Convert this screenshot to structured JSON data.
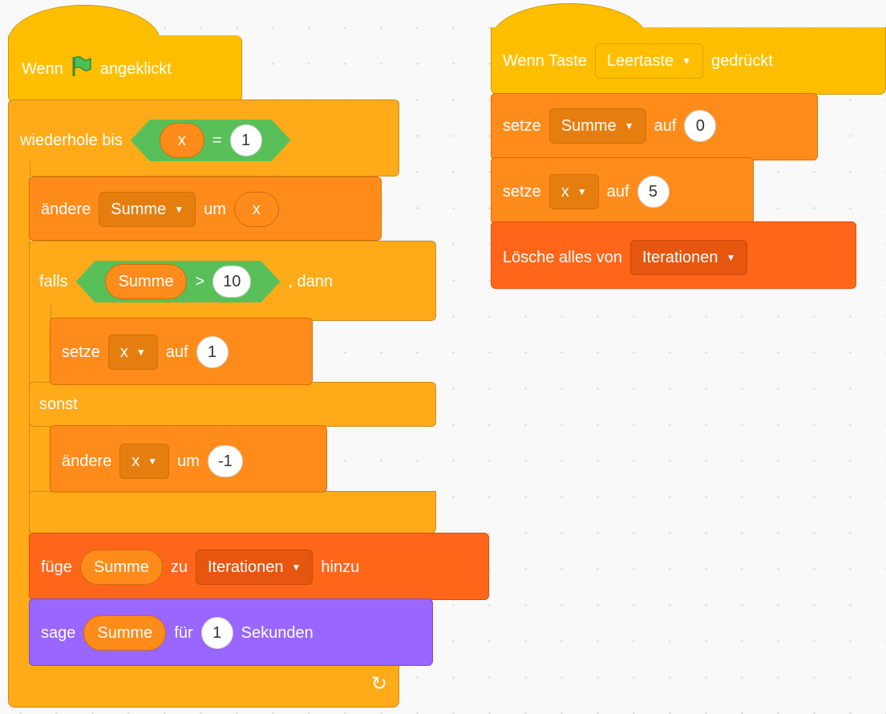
{
  "script1": {
    "hat": {
      "wenn": "Wenn",
      "flag": "green-flag-icon",
      "angeklickt": "angeklickt"
    },
    "repeat": {
      "label": "wiederhole bis",
      "var": "x",
      "op": "=",
      "value": "1"
    },
    "change1": {
      "label": "ändere",
      "var": "Summe",
      "um": "um",
      "rep": "x"
    },
    "if": {
      "falls": "falls",
      "var": "Summe",
      "op": ">",
      "value": "10",
      "dann": ", dann",
      "sonst": "sonst"
    },
    "set_x": {
      "label": "setze",
      "var": "x",
      "auf": "auf",
      "value": "1"
    },
    "change_x": {
      "label": "ändere",
      "var": "x",
      "um": "um",
      "value": "-1"
    },
    "add": {
      "label": "füge",
      "rep": "Summe",
      "zu": "zu",
      "list": "Iterationen",
      "hinzu": "hinzu"
    },
    "say": {
      "label": "sage",
      "rep": "Summe",
      "fuer": "für",
      "value": "1",
      "sek": "Sekunden"
    },
    "loop_icon": "↻"
  },
  "script2": {
    "hat": {
      "wenn": "Wenn Taste",
      "key": "Leertaste",
      "gedrueckt": "gedrückt"
    },
    "set_sum": {
      "label": "setze",
      "var": "Summe",
      "auf": "auf",
      "value": "0"
    },
    "set_x": {
      "label": "setze",
      "var": "x",
      "auf": "auf",
      "value": "5"
    },
    "delete": {
      "label": "Lösche alles von",
      "list": "Iterationen"
    }
  },
  "colors": {
    "events": "#ffbf00",
    "control": "#ffab19",
    "variables": "#ff8c1a",
    "lists": "#ff661a",
    "looks": "#9966ff",
    "operators": "#59c059"
  }
}
